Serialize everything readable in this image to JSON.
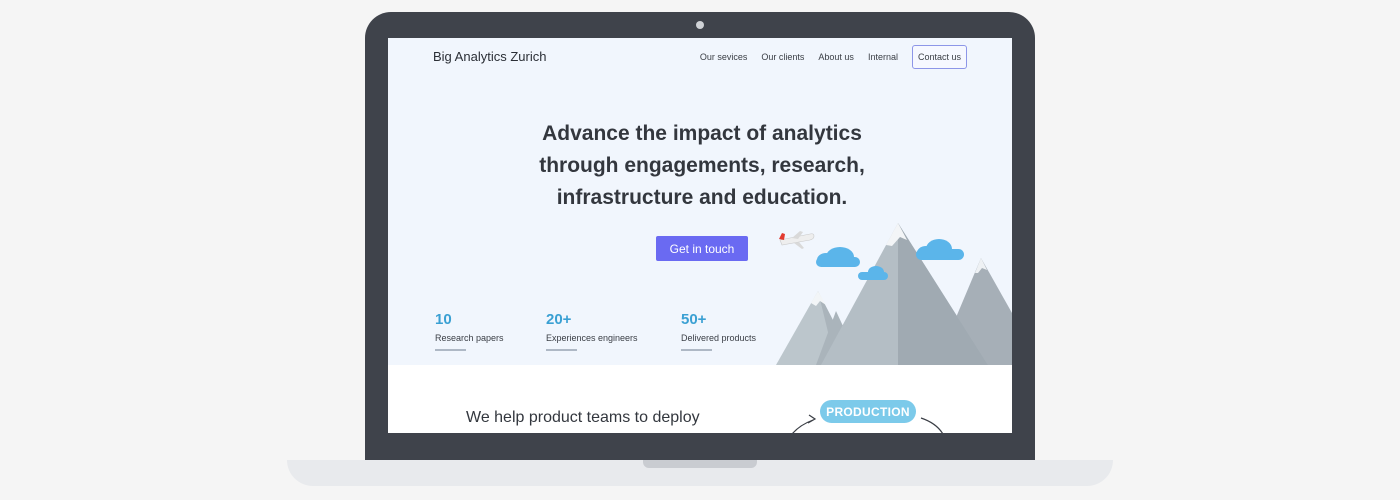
{
  "nav": {
    "brand": "Big Analytics Zurich",
    "links": [
      {
        "label": "Our sevices"
      },
      {
        "label": "Our clients"
      },
      {
        "label": "About us"
      },
      {
        "label": "Internal"
      }
    ],
    "cta": "Contact us"
  },
  "hero": {
    "title_line1": "Advance the impact of analytics",
    "title_line2": "through engagements, research,",
    "title_line3": "infrastructure and education.",
    "cta": "Get in touch"
  },
  "stats": [
    {
      "value": "10",
      "label": "Research papers"
    },
    {
      "value": "20+",
      "label": "Experiences engineers"
    },
    {
      "value": "50+",
      "label": "Delivered products"
    }
  ],
  "section2": {
    "text": "We help product teams to deploy",
    "pill": "PRODUCTION"
  },
  "colors": {
    "accent": "#6a6af2",
    "stat_number": "#3aa0d3",
    "hero_bg": "#f1f6fd",
    "pill": "#7ccaea"
  }
}
